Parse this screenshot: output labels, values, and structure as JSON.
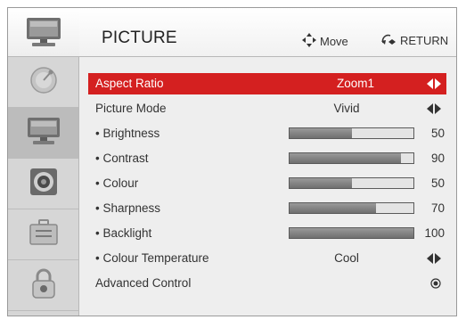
{
  "header": {
    "title": "PICTURE",
    "move_hint": "Move",
    "return_hint": "RETURN"
  },
  "sidebar": {
    "items": [
      {
        "icon": "satellite-dish-icon",
        "active": false
      },
      {
        "icon": "tv-monitor-icon",
        "active": true
      },
      {
        "icon": "speaker-icon",
        "active": false
      },
      {
        "icon": "toolbox-icon",
        "active": false
      },
      {
        "icon": "padlock-icon",
        "active": false
      }
    ]
  },
  "menu": {
    "aspect_ratio": {
      "label": "Aspect Ratio",
      "value": "Zoom1"
    },
    "picture_mode": {
      "label": "Picture Mode",
      "value": "Vivid"
    },
    "brightness": {
      "label": "• Brightness",
      "value": 50,
      "max": 100
    },
    "contrast": {
      "label": "• Contrast",
      "value": 90,
      "max": 100
    },
    "colour": {
      "label": "• Colour",
      "value": 50,
      "max": 100
    },
    "sharpness": {
      "label": "• Sharpness",
      "value": 70,
      "max": 100
    },
    "backlight": {
      "label": "• Backlight",
      "value": 100,
      "max": 100
    },
    "colour_temperature": {
      "label": "• Colour Temperature",
      "value": "Cool"
    },
    "advanced_control": {
      "label": "Advanced Control"
    }
  },
  "colors": {
    "selection": "#d42020",
    "bar_fill": "#7f7f7f"
  }
}
